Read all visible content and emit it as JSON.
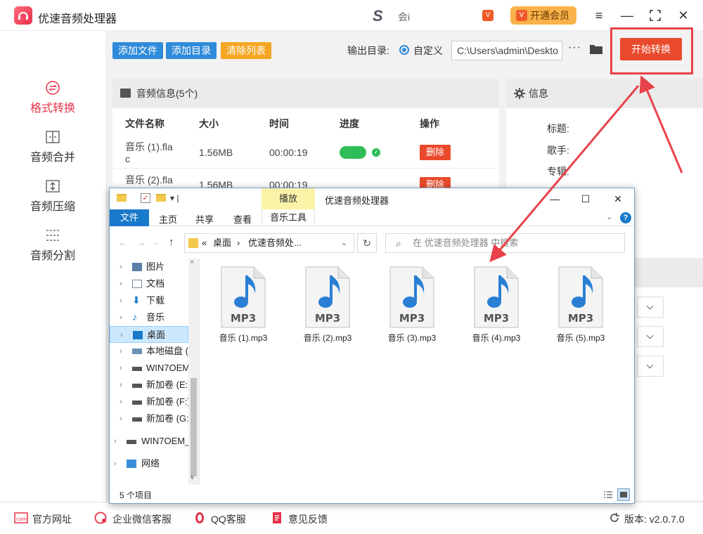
{
  "app": {
    "title": "优速音频处理器",
    "user_name": "会i",
    "vip_badge": "V",
    "vip_button": "开通会员"
  },
  "sidebar": {
    "items": [
      {
        "label": "格式转换",
        "active": true
      },
      {
        "label": "音频合并",
        "active": false
      },
      {
        "label": "音频压缩",
        "active": false
      },
      {
        "label": "音频分割",
        "active": false
      }
    ]
  },
  "toolbar": {
    "add_file": "添加文件",
    "add_dir": "添加目录",
    "clear_list": "清除列表",
    "output_label": "输出目录:",
    "custom_label": "自定义",
    "output_path": "C:\\Users\\admin\\Deskto",
    "more": "···",
    "start": "开始转换"
  },
  "audio_panel": {
    "title": "音频信息(5个)",
    "columns": [
      "文件名称",
      "大小",
      "时间",
      "进度",
      "操作"
    ],
    "rows": [
      {
        "name_line1": "音乐 (1).fla",
        "name_line2": "c",
        "size": "1.56MB",
        "time": "00:00:19",
        "action": "删除"
      },
      {
        "name_line1": "音乐 (2).fla",
        "name_line2": "",
        "size": "1.56MB",
        "time": "00:00:19",
        "action": "删除"
      }
    ]
  },
  "info_panel": {
    "title": "信息",
    "labels": [
      "标题:",
      "歌手:",
      "专辑:"
    ]
  },
  "footer": {
    "site": "官方网址",
    "wechat": "企业微信客服",
    "qq": "QQ客服",
    "feedback": "意见反馈",
    "version": "版本: v2.0.7.0"
  },
  "explorer": {
    "title": "优速音频处理器",
    "context_tab": "播放",
    "ribbon": {
      "file": "文件",
      "home": "主页",
      "share": "共享",
      "view": "查看",
      "tools": "音乐工具"
    },
    "address": {
      "prefix": "«",
      "segment1": "桌面",
      "sep": "›",
      "segment2": "优速音频处..."
    },
    "search_placeholder": "在 优速音频处理器 中搜索",
    "tree": [
      {
        "label": "图片",
        "icon": "pictures-icon"
      },
      {
        "label": "文档",
        "icon": "documents-icon"
      },
      {
        "label": "下载",
        "icon": "download-icon"
      },
      {
        "label": "音乐",
        "icon": "music-icon"
      },
      {
        "label": "桌面",
        "icon": "desktop-icon",
        "selected": true
      },
      {
        "label": "本地磁盘 (",
        "icon": "drive-icon"
      },
      {
        "label": "WIN7OEM",
        "icon": "drive-icon"
      },
      {
        "label": "新加卷 (E:)",
        "icon": "drive-icon"
      },
      {
        "label": "新加卷 (F:)",
        "icon": "drive-icon"
      },
      {
        "label": "新加卷 (G:",
        "icon": "drive-icon"
      },
      {
        "label": "WIN7OEM_",
        "icon": "drive-icon"
      },
      {
        "label": "网络",
        "icon": "network-icon"
      }
    ],
    "files": [
      {
        "name": "音乐 (1).mp3",
        "type": "MP3"
      },
      {
        "name": "音乐 (2).mp3",
        "type": "MP3"
      },
      {
        "name": "音乐 (3).mp3",
        "type": "MP3"
      },
      {
        "name": "音乐 (4).mp3",
        "type": "MP3"
      },
      {
        "name": "音乐 (5).mp3",
        "type": "MP3"
      }
    ],
    "status": "5 个项目"
  },
  "colors": {
    "accent_red": "#e8324a",
    "button_blue": "#2f8bd9",
    "button_orange": "#f5a623",
    "start_red": "#ea4a2c",
    "progress_green": "#2fbd5a",
    "annotation_red": "#e8434a"
  }
}
